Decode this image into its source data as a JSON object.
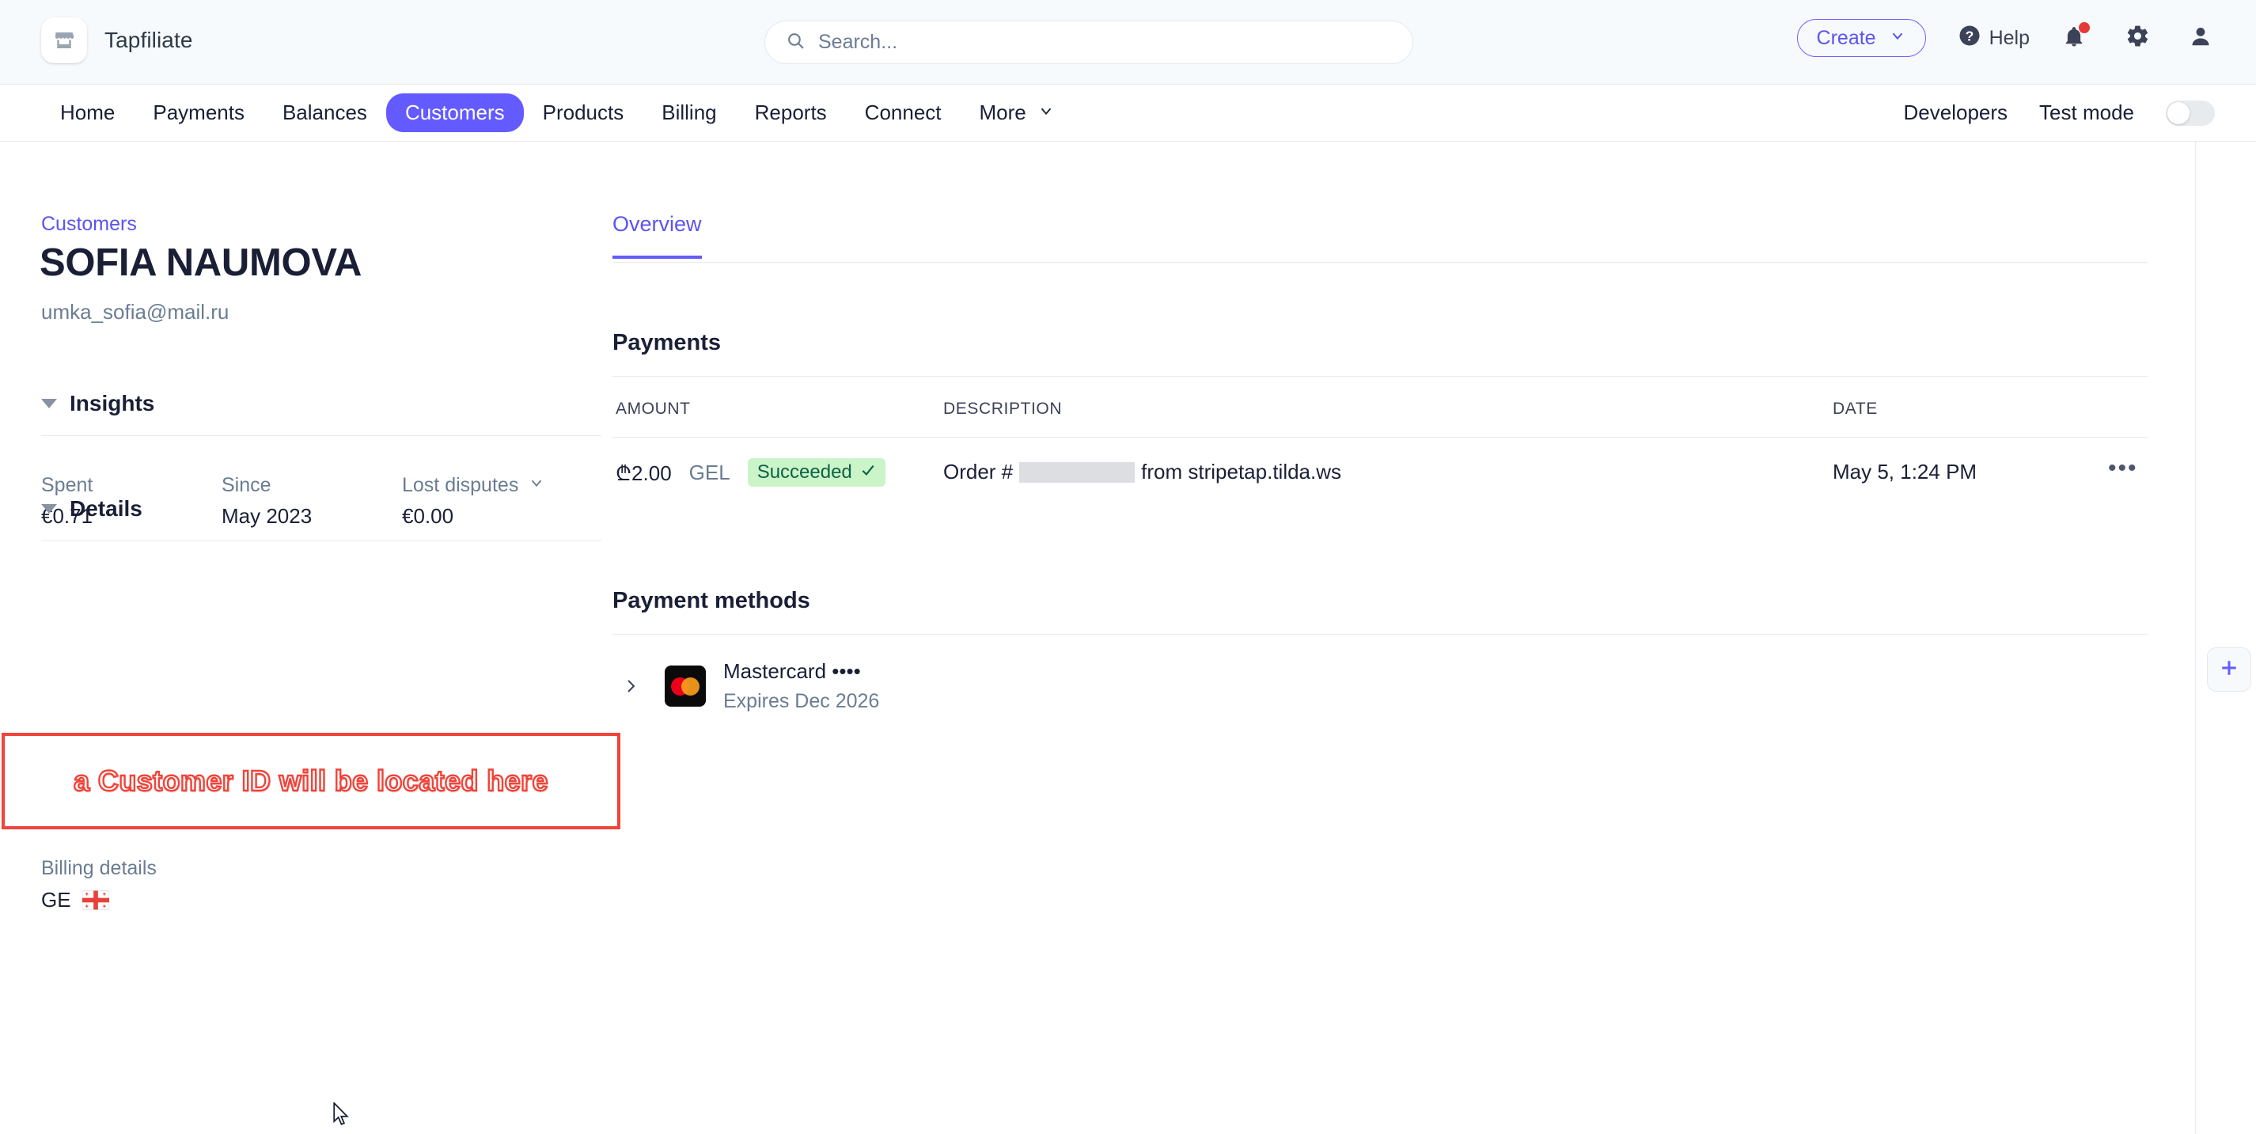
{
  "topbar": {
    "brand_name": "Tapfiliate",
    "brand_logo_icon": "store-icon",
    "search": {
      "placeholder": "Search...",
      "icon": "search-icon",
      "value": ""
    },
    "create_label": "Create",
    "create_chevron_icon": "chevron-down-icon",
    "help_label": "Help",
    "help_icon": "question-circle-icon",
    "notifications_icon": "bell-icon",
    "notifications_has_unread": true,
    "settings_icon": "gear-icon",
    "account_icon": "user-avatar-icon"
  },
  "nav": {
    "items": [
      {
        "label": "Home",
        "active": false
      },
      {
        "label": "Payments",
        "active": false
      },
      {
        "label": "Balances",
        "active": false
      },
      {
        "label": "Customers",
        "active": true
      },
      {
        "label": "Products",
        "active": false
      },
      {
        "label": "Billing",
        "active": false
      },
      {
        "label": "Reports",
        "active": false
      },
      {
        "label": "Connect",
        "active": false
      },
      {
        "label": "More",
        "active": false,
        "chevron_icon": "chevron-down-icon"
      }
    ],
    "developers_label": "Developers",
    "test_mode_label": "Test mode",
    "test_mode_on": false
  },
  "customer": {
    "breadcrumb": "Customers",
    "name": "SOFIA NAUMOVA",
    "email": "umka_sofia@mail.ru"
  },
  "insights": {
    "title": "Insights",
    "collapse_icon": "caret-down-icon",
    "stats": [
      {
        "label": "Spent",
        "value": "€0.71"
      },
      {
        "label": "Since",
        "value": "May 2023"
      },
      {
        "label": "Lost disputes",
        "value": "€0.00",
        "chevron_icon": "chevron-down-icon"
      }
    ]
  },
  "details": {
    "title": "Details",
    "collapse_icon": "caret-down-icon",
    "annotation": "a Customer ID will be located here",
    "annotation_border_color": "#f0443a",
    "billing_label": "Billing details",
    "billing_country": "GE",
    "billing_flag_icon": "georgia-flag-icon"
  },
  "main": {
    "tabs": [
      {
        "label": "Overview",
        "active": true
      }
    ],
    "payments": {
      "title": "Payments",
      "columns": [
        "AMOUNT",
        "DESCRIPTION",
        "DATE"
      ],
      "rows": [
        {
          "amount": "₾2.00",
          "currency": "GEL",
          "status": "Succeeded",
          "status_icon": "check-icon",
          "description_prefix": "Order #",
          "description_redacted": true,
          "description_suffix": "from stripetap.tilda.ws",
          "date": "May 5, 1:24 PM",
          "menu_icon": "overflow-menu-icon"
        }
      ]
    },
    "payment_methods": {
      "title": "Payment methods",
      "items": [
        {
          "expand_icon": "chevron-right-icon",
          "brand_icon": "mastercard-icon",
          "title": "Mastercard ••••",
          "subtitle": "Expires Dec 2026"
        }
      ]
    }
  },
  "right_rail": {
    "add_icon": "plus-icon"
  },
  "colors": {
    "brand_purple": "#635bff",
    "link_purple": "#5b54f0",
    "success_bg": "#cbf4c9",
    "success_fg": "#0e6245",
    "annotation_red": "#f0443a"
  }
}
